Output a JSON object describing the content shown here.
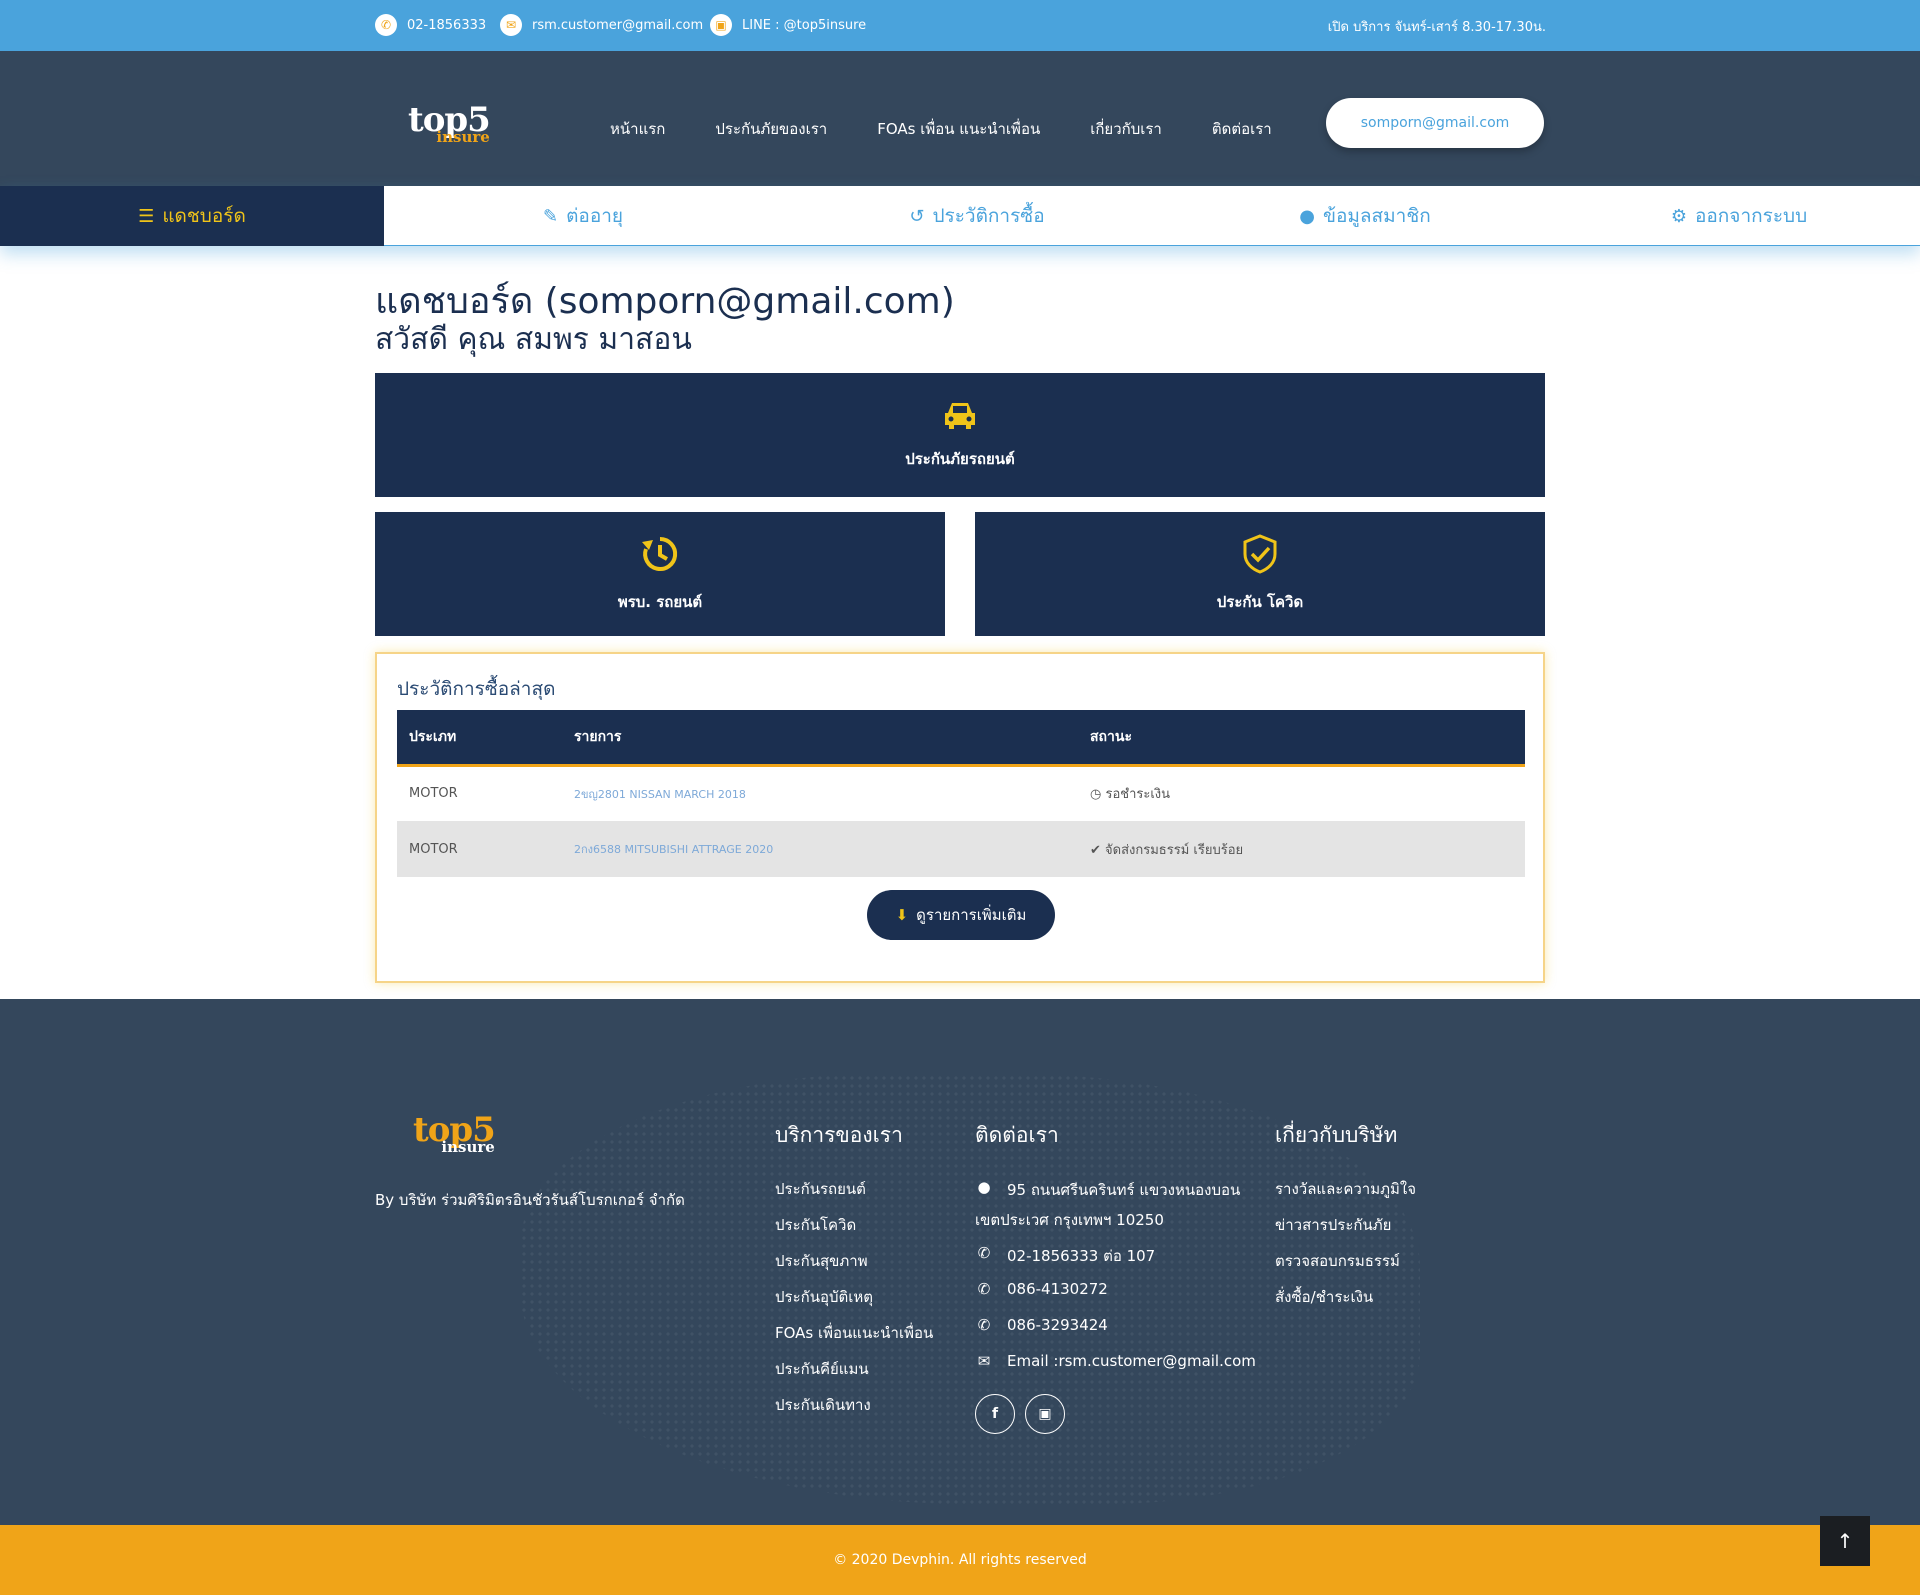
{
  "topbar": {
    "phone": "02-1856333",
    "email": "rsm.customer@gmail.com",
    "line": "LINE : @top5insure",
    "hours": "เปิด บริการ จันทร์-เสาร์ 8.30-17.30น."
  },
  "logo": {
    "main": "top5",
    "sub": "insure"
  },
  "nav": [
    "หน้าแรก",
    "ประกันภัยของเรา",
    "FOAs เพื่อน แนะนำเพื่อน",
    "เกี่ยวกับเรา",
    "ติดต่อเรา"
  ],
  "user_email": "somporn@gmail.com",
  "tabs": [
    {
      "label": "แดชบอร์ด",
      "icon": "list-icon"
    },
    {
      "label": "ต่ออายุ",
      "icon": "edit-icon"
    },
    {
      "label": "ประวัติการซื้อ",
      "icon": "history-icon"
    },
    {
      "label": "ข้อมูลสมาชิก",
      "icon": "user-icon"
    },
    {
      "label": "ออกจากระบบ",
      "icon": "gear-icon"
    }
  ],
  "heading": "แดชบอร์ด (somporn@gmail.com)",
  "greeting": "สวัสดี คุณ สมพร มาสอน",
  "cards": [
    {
      "label": "ประกันภัยรถยนต์",
      "icon": "car-icon"
    },
    {
      "label": "พรบ. รถยนต์",
      "icon": "history-icon"
    },
    {
      "label": "ประกัน โควิด",
      "icon": "shield-check-icon"
    }
  ],
  "history": {
    "title": "ประวัติการซื้อล่าสุด",
    "columns": [
      "ประเภท",
      "รายการ",
      "สถานะ"
    ],
    "rows": [
      {
        "type": "MOTOR",
        "item": "2ขญ2801 NISSAN MARCH 2018",
        "status": "รอชำระเงิน"
      },
      {
        "type": "MOTOR",
        "item": "2กง6588 MITSUBISHI ATTRAGE 2020",
        "status": "จัดส่งกรมธรรม์ เรียบร้อย"
      }
    ],
    "more_label": "ดูรายการเพิ่มเติม"
  },
  "footer": {
    "by": "By บริษัท ร่วมศิริมิตรอินชัวรันส์โบรกเกอร์ จำกัด",
    "services_title": "บริการของเรา",
    "services": [
      "ประกันรถยนต์",
      "ประกันโควิด",
      "ประกันสุขภาพ",
      "ประกันอุบัติเหตุ",
      "FOAs เพื่อนแนะนำเพื่อน",
      "ประกันคีย์แมน",
      "ประกันเดินทาง"
    ],
    "contact_title": "ติดต่อเรา",
    "address_line1": "95 ถนนศรีนครินทร์ แขวงหนองบอน",
    "address_line2": "เขตประเวศ กรุงเทพฯ 10250",
    "phones": [
      "02-1856333 ต่อ 107",
      "086-4130272",
      "086-3293424"
    ],
    "email": "Email :rsm.customer@gmail.com",
    "about_title": "เกี่ยวกับบริษัท",
    "about": [
      "รางวัลและความภูมิใจ",
      "ข่าวสารประกันภัย",
      "ตรวจสอบกรมธรรม์",
      "สั่งซื้อ/ชำระเงิน"
    ],
    "copyright": "© 2020 Devphin. All rights reserved"
  },
  "colors": {
    "primary": "#1b2f50",
    "accent": "#f0a418",
    "topbar": "#4aa3dc",
    "header": "#34475c"
  }
}
